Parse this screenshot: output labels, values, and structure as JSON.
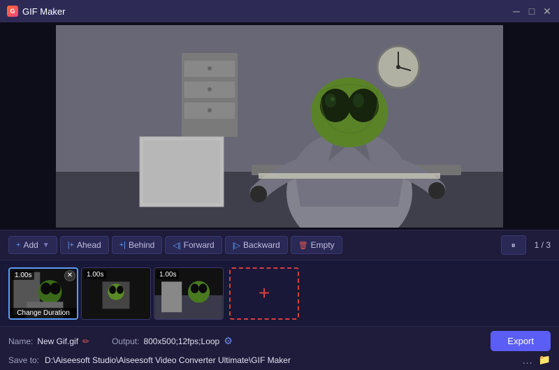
{
  "window": {
    "title": "GIF Maker",
    "controls": [
      "minimize",
      "maximize",
      "close"
    ]
  },
  "toolbar": {
    "add_label": "Add",
    "ahead_label": "Ahead",
    "behind_label": "Behind",
    "forward_label": "Forward",
    "backward_label": "Backward",
    "empty_label": "Empty",
    "play_icon": "⏸",
    "frame_counter": "1 / 3"
  },
  "timeline": {
    "frames": [
      {
        "duration": "1.00s",
        "active": true,
        "label": "Change Duration"
      },
      {
        "duration": "1.00s",
        "active": false,
        "label": ""
      },
      {
        "duration": "1.00s",
        "active": false,
        "label": ""
      }
    ],
    "add_frame_label": "+"
  },
  "bottom": {
    "name_label": "Name:",
    "name_value": "New Gif.gif",
    "output_label": "Output:",
    "output_value": "800x500;12fps;Loop",
    "export_label": "Export",
    "save_label": "Save to:",
    "save_path": "D:\\Aiseesoft Studio\\Aiseesoft Video Converter Ultimate\\GIF Maker",
    "more_label": "...",
    "gear_icon": "⚙"
  }
}
